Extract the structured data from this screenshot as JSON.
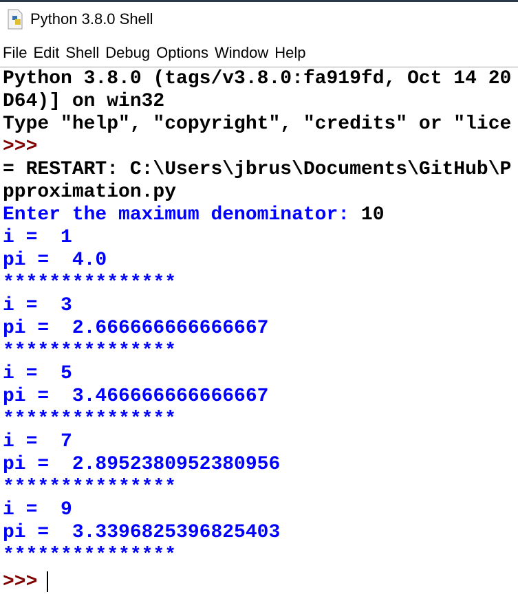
{
  "window": {
    "title": "Python 3.8.0 Shell"
  },
  "menu": [
    "File",
    "Edit",
    "Shell",
    "Debug",
    "Options",
    "Window",
    "Help"
  ],
  "shell": {
    "banner": [
      "Python 3.8.0 (tags/v3.8.0:fa919fd, Oct 14 20",
      "D64)] on win32",
      "Type \"help\", \"copyright\", \"credits\" or \"lice"
    ],
    "prompt": ">>>",
    "restart": [
      "= RESTART: C:\\Users\\jbrus\\Documents\\GitHub\\P",
      "pproximation.py"
    ],
    "input_prompt": "Enter the maximum denominator: ",
    "input_value": "10",
    "output": [
      "i =  1",
      "pi =  4.0",
      "***************",
      "i =  3",
      "pi =  2.666666666666667",
      "***************",
      "i =  5",
      "pi =  3.466666666666667",
      "***************",
      "i =  7",
      "pi =  2.8952380952380956",
      "***************",
      "i =  9",
      "pi =  3.3396825396825403",
      "***************"
    ]
  }
}
